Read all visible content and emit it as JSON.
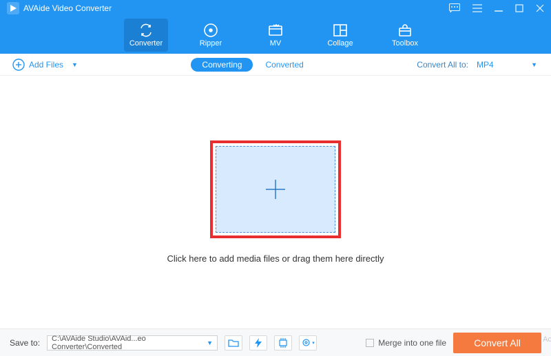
{
  "titlebar": {
    "title": "AVAide Video Converter"
  },
  "tabs": {
    "converter": "Converter",
    "ripper": "Ripper",
    "mv": "MV",
    "collage": "Collage",
    "toolbox": "Toolbox"
  },
  "subbar": {
    "add_files": "Add Files",
    "mode_active": "Converting",
    "mode_other": "Converted",
    "convert_to_label": "Convert All to:",
    "format_selected": "MP4"
  },
  "main": {
    "drop_hint": "Click here to add media files or drag them here directly"
  },
  "footer": {
    "save_to_label": "Save to:",
    "save_path": "C:\\AVAide Studio\\AVAid...eo Converter\\Converted",
    "merge_label": "Merge into one file",
    "convert_all": "Convert All"
  },
  "watermark": "Act"
}
